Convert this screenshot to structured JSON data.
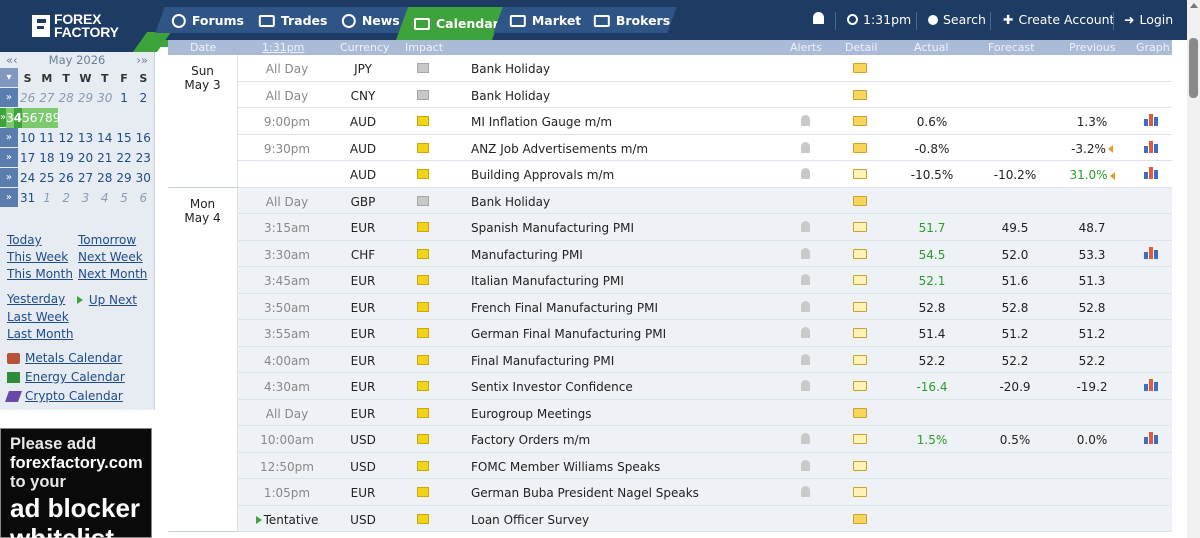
{
  "logo": {
    "line1": "FOREX",
    "line2": "FACTORY"
  },
  "nav": [
    {
      "label": "Forums",
      "icon": "forums-icon"
    },
    {
      "label": "Trades",
      "icon": "trades-icon"
    },
    {
      "label": "News",
      "icon": "news-icon"
    },
    {
      "label": "Calendar",
      "icon": "calendar-icon",
      "active": true
    },
    {
      "label": "Market",
      "icon": "market-icon"
    },
    {
      "label": "Brokers",
      "icon": "brokers-icon"
    }
  ],
  "header_right": {
    "time": "1:31pm",
    "search": "Search",
    "create": "Create Account",
    "login": "Login"
  },
  "mini_calendar": {
    "title": "May 2026",
    "nav": {
      "prev_year": "«",
      "prev": "‹",
      "next": "›",
      "next_year": "»"
    },
    "weekdays": [
      "S",
      "M",
      "T",
      "W",
      "T",
      "F",
      "S"
    ],
    "weeks": [
      {
        "days": [
          "26",
          "27",
          "28",
          "29",
          "30",
          "1",
          "2"
        ],
        "other": [
          true,
          true,
          true,
          true,
          true,
          false,
          false
        ]
      },
      {
        "days": [
          "3",
          "4",
          "5",
          "6",
          "7",
          "8",
          "9"
        ],
        "other": [
          false,
          false,
          false,
          false,
          false,
          false,
          false
        ],
        "current": true,
        "today_index": 1
      },
      {
        "days": [
          "10",
          "11",
          "12",
          "13",
          "14",
          "15",
          "16"
        ],
        "other": [
          false,
          false,
          false,
          false,
          false,
          false,
          false
        ]
      },
      {
        "days": [
          "17",
          "18",
          "19",
          "20",
          "21",
          "22",
          "23"
        ],
        "other": [
          false,
          false,
          false,
          false,
          false,
          false,
          false
        ]
      },
      {
        "days": [
          "24",
          "25",
          "26",
          "27",
          "28",
          "29",
          "30"
        ],
        "other": [
          false,
          false,
          false,
          false,
          false,
          false,
          false
        ]
      },
      {
        "days": [
          "31",
          "1",
          "2",
          "3",
          "4",
          "5",
          "6"
        ],
        "other": [
          false,
          true,
          true,
          true,
          true,
          true,
          true
        ]
      }
    ]
  },
  "period_links": {
    "today": "Today",
    "tomorrow": "Tomorrow",
    "this_week": "This Week",
    "next_week": "Next Week",
    "this_month": "This Month",
    "next_month": "Next Month",
    "yesterday": "Yesterday",
    "up_next": "Up Next",
    "last_week": "Last Week",
    "last_month": "Last Month"
  },
  "other_calendars": [
    "Metals Calendar",
    "Energy Calendar",
    "Crypto Calendar"
  ],
  "ad": {
    "line1": "Please add",
    "line2": "forexfactory.com",
    "line3": "to your",
    "line4": "ad blocker",
    "line5": "whitelist"
  },
  "columns": {
    "date": "Date",
    "time": "1:31pm",
    "currency": "Currency",
    "impact": "Impact",
    "alerts": "Alerts",
    "detail": "Detail",
    "actual": "Actual",
    "forecast": "Forecast",
    "previous": "Previous",
    "graph": "Graph"
  },
  "days": [
    {
      "day": "Sun",
      "date": "May 3"
    },
    {
      "day": "Mon",
      "date": "May 4"
    }
  ],
  "events": [
    {
      "time": "All Day",
      "cur": "JPY",
      "impact": "gray",
      "name": "Bank Holiday",
      "actual": "",
      "forecast": "",
      "previous": "",
      "alert": false,
      "graph": false
    },
    {
      "time": "All Day",
      "cur": "CNY",
      "impact": "gray",
      "name": "Bank Holiday",
      "actual": "",
      "forecast": "",
      "previous": "",
      "alert": false,
      "graph": false
    },
    {
      "time": "9:00pm",
      "cur": "AUD",
      "impact": "yellow",
      "name": "MI Inflation Gauge m/m",
      "actual": "0.6%",
      "forecast": "",
      "previous": "1.3%",
      "alert": true,
      "graph": true
    },
    {
      "time": "9:30pm",
      "cur": "AUD",
      "impact": "yellow",
      "name": "ANZ Job Advertisements m/m",
      "actual": "-0.8%",
      "forecast": "",
      "previous": "-3.2%",
      "alert": true,
      "graph": true,
      "revised": true
    },
    {
      "time": "",
      "cur": "AUD",
      "impact": "yellow",
      "name": "Building Approvals m/m",
      "actual": "-10.5%",
      "forecast": "-10.2%",
      "previous": "31.0%",
      "alert": true,
      "graph": true,
      "revised": true,
      "prev_green": true,
      "detail_open": true
    },
    {
      "time": "All Day",
      "cur": "GBP",
      "impact": "gray",
      "name": "Bank Holiday",
      "actual": "",
      "forecast": "",
      "previous": "",
      "alert": false,
      "graph": false
    },
    {
      "time": "3:15am",
      "cur": "EUR",
      "impact": "yellow",
      "name": "Spanish Manufacturing PMI",
      "actual": "51.7",
      "forecast": "49.5",
      "previous": "48.7",
      "alert": true,
      "graph": false,
      "act_green": true,
      "detail_open": true
    },
    {
      "time": "3:30am",
      "cur": "CHF",
      "impact": "yellow",
      "name": "Manufacturing PMI",
      "actual": "54.5",
      "forecast": "52.0",
      "previous": "53.3",
      "alert": true,
      "graph": true,
      "act_green": true,
      "detail_open": true
    },
    {
      "time": "3:45am",
      "cur": "EUR",
      "impact": "yellow",
      "name": "Italian Manufacturing PMI",
      "actual": "52.1",
      "forecast": "51.6",
      "previous": "51.3",
      "alert": true,
      "graph": false,
      "act_green": true,
      "detail_open": true
    },
    {
      "time": "3:50am",
      "cur": "EUR",
      "impact": "yellow",
      "name": "French Final Manufacturing PMI",
      "actual": "52.8",
      "forecast": "52.8",
      "previous": "52.8",
      "alert": true,
      "graph": false,
      "detail_open": true
    },
    {
      "time": "3:55am",
      "cur": "EUR",
      "impact": "yellow",
      "name": "German Final Manufacturing PMI",
      "actual": "51.4",
      "forecast": "51.2",
      "previous": "51.2",
      "alert": true,
      "graph": false,
      "detail_open": true
    },
    {
      "time": "4:00am",
      "cur": "EUR",
      "impact": "yellow",
      "name": "Final Manufacturing PMI",
      "actual": "52.2",
      "forecast": "52.2",
      "previous": "52.2",
      "alert": true,
      "graph": false,
      "detail_open": true
    },
    {
      "time": "4:30am",
      "cur": "EUR",
      "impact": "yellow",
      "name": "Sentix Investor Confidence",
      "actual": "-16.4",
      "forecast": "-20.9",
      "previous": "-19.2",
      "alert": true,
      "graph": true,
      "act_green": true,
      "detail_open": true
    },
    {
      "time": "All Day",
      "cur": "EUR",
      "impact": "yellow",
      "name": "Eurogroup Meetings",
      "actual": "",
      "forecast": "",
      "previous": "",
      "alert": false,
      "graph": false
    },
    {
      "time": "10:00am",
      "cur": "USD",
      "impact": "yellow",
      "name": "Factory Orders m/m",
      "actual": "1.5%",
      "forecast": "0.5%",
      "previous": "0.0%",
      "alert": true,
      "graph": true,
      "act_green": true,
      "detail_open": true
    },
    {
      "time": "12:50pm",
      "cur": "USD",
      "impact": "yellow",
      "name": "FOMC Member Williams Speaks",
      "actual": "",
      "forecast": "",
      "previous": "",
      "alert": true,
      "graph": false,
      "detail_open": true
    },
    {
      "time": "1:05pm",
      "cur": "EUR",
      "impact": "yellow",
      "name": "German Buba President Nagel Speaks",
      "actual": "",
      "forecast": "",
      "previous": "",
      "alert": true,
      "graph": false,
      "detail_open": true
    },
    {
      "time": "Tentative",
      "cur": "USD",
      "impact": "yellow",
      "name": "Loan Officer Survey",
      "actual": "",
      "forecast": "",
      "previous": "",
      "alert": false,
      "graph": false,
      "upnext": true
    }
  ]
}
